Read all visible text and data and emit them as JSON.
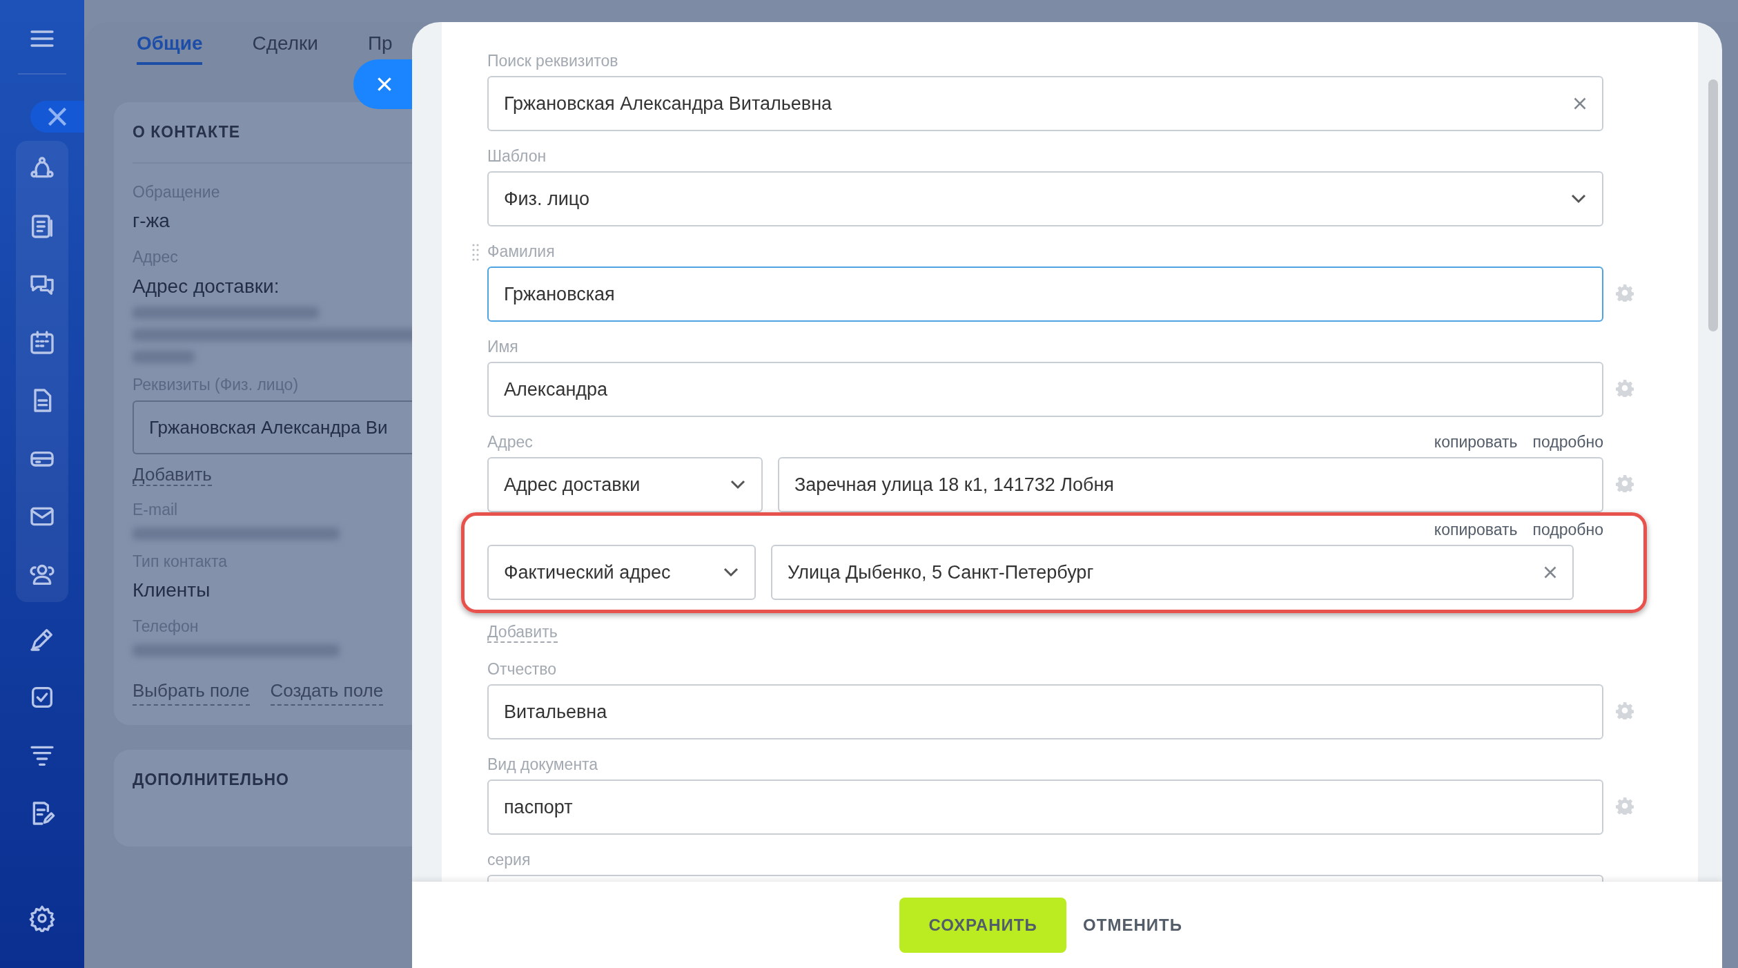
{
  "contact_card": {
    "tabs": [
      {
        "label": "Общие",
        "selected": true
      },
      {
        "label": "Сделки",
        "selected": false
      },
      {
        "label": "Пр",
        "selected": false
      }
    ],
    "section_title": "О КОНТАКТЕ",
    "fields": [
      {
        "kind": "text",
        "label": "Обращение",
        "value": "г-жа"
      },
      {
        "kind": "address",
        "label": "Адрес",
        "value": "Адрес доставки:"
      },
      {
        "kind": "requisite",
        "label": "Реквизиты (Физ. лицо)",
        "value": "Гржановская Александра Ви",
        "link": "Добавить"
      },
      {
        "kind": "blurred",
        "label": "E-mail"
      },
      {
        "kind": "text",
        "label": "Тип контакта",
        "value": "Клиенты"
      },
      {
        "kind": "blurred",
        "label": "Телефон"
      }
    ],
    "links": [
      "Выбрать поле",
      "Создать поле"
    ],
    "second_section_title": "ДОПОЛНИТЕЛЬНО"
  },
  "modal": {
    "fields": [
      {
        "kind": "text",
        "label": "Поиск реквизитов",
        "value": "Гржановская Александра Витальевна",
        "clear": true,
        "gear": false,
        "focused": false,
        "drag_handle": false
      },
      {
        "kind": "select",
        "label": "Шаблон",
        "value": "Физ. лицо",
        "clear": false,
        "gear": false,
        "focused": false,
        "drag_handle": false
      },
      {
        "kind": "text",
        "label": "Фамилия",
        "value": "Гржановская",
        "clear": false,
        "gear": true,
        "focused": true,
        "drag_handle": true
      },
      {
        "kind": "text",
        "label": "Имя",
        "value": "Александра",
        "clear": false,
        "gear": true,
        "focused": false,
        "drag_handle": false
      },
      {
        "kind": "address",
        "label": "Адрес",
        "links": [
          "копировать",
          "подробно"
        ],
        "type": "Адрес доставки",
        "value": "Заречная улица 18 к1, 141732 Лобня",
        "clear": false,
        "gear": true,
        "highlighted": false
      },
      {
        "kind": "address",
        "links": [
          "копировать",
          "подробно"
        ],
        "type": "Фактический адрес",
        "value": "Улица Дыбенко, 5 Санкт-Петербург",
        "clear": true,
        "gear": false,
        "highlighted": true
      },
      {
        "kind": "link",
        "label": "Добавить"
      },
      {
        "kind": "text",
        "label": "Отчество",
        "value": "Витальевна",
        "clear": false,
        "gear": true,
        "focused": false,
        "drag_handle": false
      },
      {
        "kind": "text",
        "label": "Вид документа",
        "value": "паспорт",
        "clear": false,
        "gear": true,
        "focused": false,
        "drag_handle": false
      },
      {
        "kind": "text",
        "label": "серия",
        "clear": false,
        "gear": false,
        "focused": false,
        "drag_handle": false
      }
    ],
    "buttons": [
      {
        "kind": "primary",
        "label": "СОХРАНИТЬ"
      },
      {
        "kind": "plain",
        "label": "ОТМЕНИТЬ"
      }
    ]
  }
}
